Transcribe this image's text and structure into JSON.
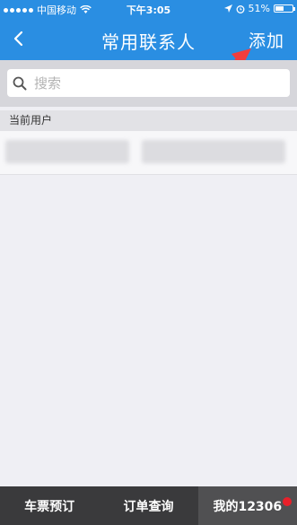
{
  "status_bar": {
    "carrier": "中国移动",
    "time": "下午3:05",
    "battery": "51%",
    "battery_level": 0.51,
    "icons": [
      "signal-dots-icon",
      "wifi-icon",
      "location-icon",
      "alarm-icon",
      "battery-icon"
    ]
  },
  "nav": {
    "back_icon": "chevron-left-icon",
    "title": "常用联系人",
    "add_label": "添加",
    "annotation": "red-arrow-icon"
  },
  "search": {
    "placeholder": "搜索",
    "icon": "search-icon"
  },
  "section": {
    "header": "当前用户"
  },
  "tabs": [
    {
      "label": "车票预订"
    },
    {
      "label": "订单查询"
    },
    {
      "label": "我的12306",
      "active": true,
      "badge": "red-dot"
    }
  ],
  "colors": {
    "header_blue": "#2a8ee2",
    "tabbar": "#3a3a3c",
    "tab_active": "#505052",
    "badge_red": "#e8202a",
    "arrow_red": "#f23d3d"
  }
}
